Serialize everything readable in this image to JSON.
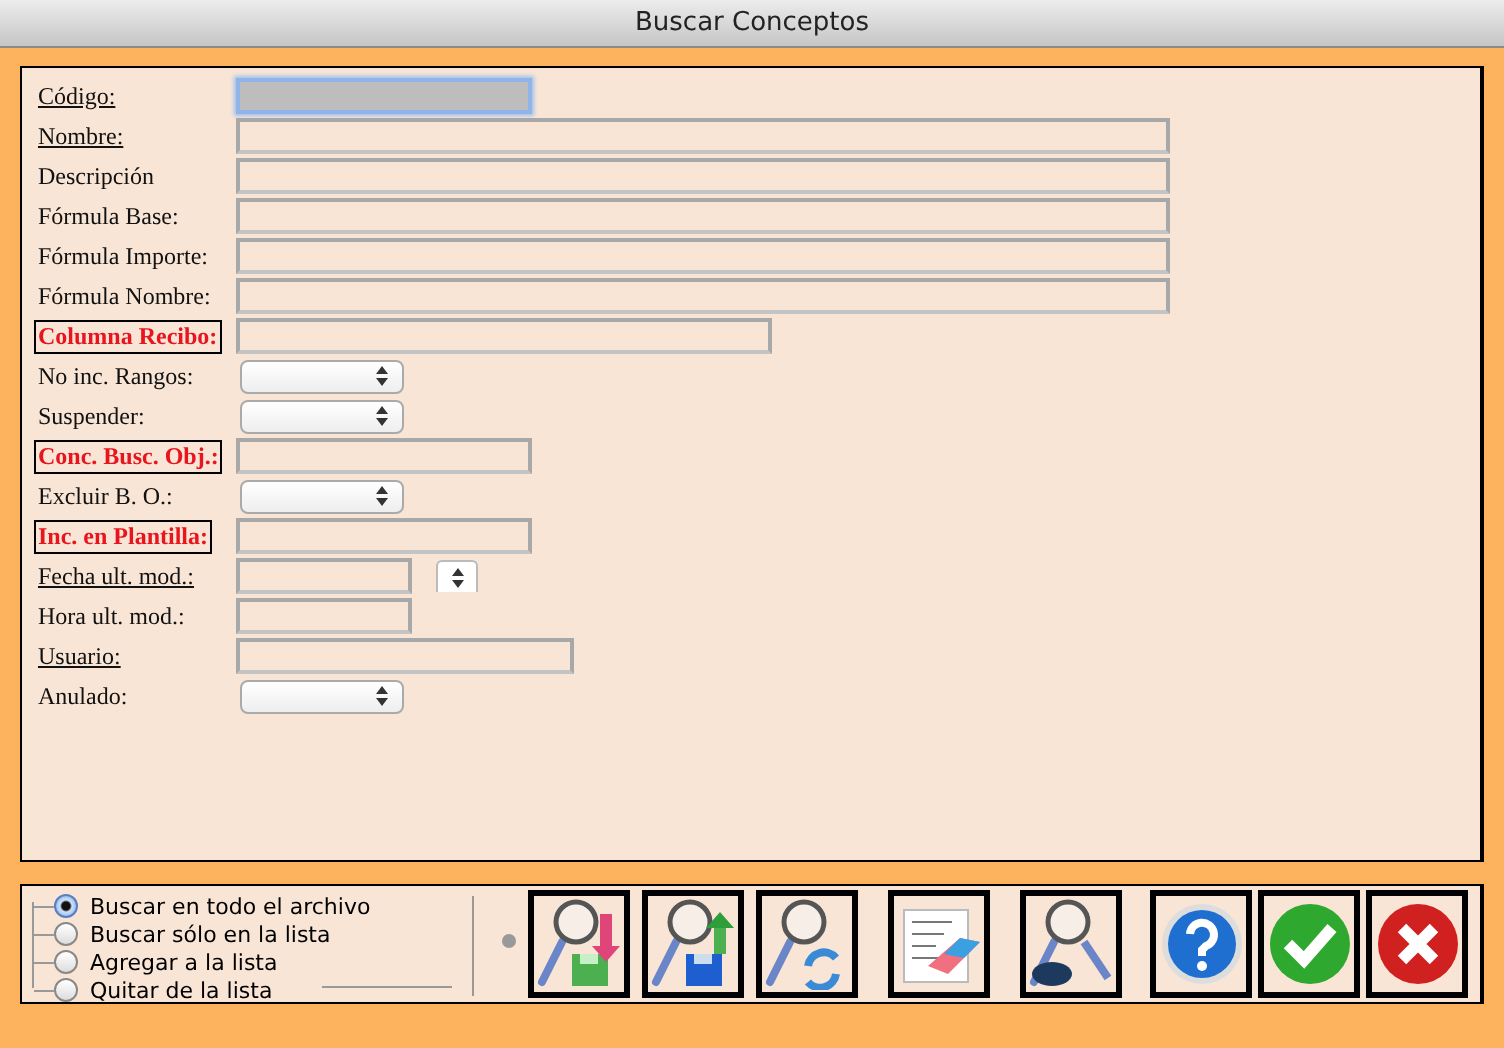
{
  "window": {
    "title": "Buscar Conceptos"
  },
  "fields": [
    {
      "label": "Código:",
      "required": true,
      "highlighted": false,
      "kind": "text-medium",
      "focused": true
    },
    {
      "label": "Nombre:",
      "required": true,
      "highlighted": false,
      "kind": "text-wide",
      "focused": false
    },
    {
      "label": "Descripción",
      "required": false,
      "highlighted": false,
      "kind": "text-wide",
      "focused": false
    },
    {
      "label": "Fórmula Base:",
      "required": false,
      "highlighted": false,
      "kind": "text-wide",
      "focused": false
    },
    {
      "label": "Fórmula Importe:",
      "required": false,
      "highlighted": false,
      "kind": "text-wide",
      "focused": false
    },
    {
      "label": "Fórmula Nombre:",
      "required": false,
      "highlighted": false,
      "kind": "text-wide",
      "focused": false
    },
    {
      "label": "Columna Recibo:",
      "required": false,
      "highlighted": true,
      "kind": "text-long",
      "focused": false
    },
    {
      "label": "No inc. Rangos:",
      "required": false,
      "highlighted": false,
      "kind": "popup",
      "focused": false
    },
    {
      "label": "Suspender:",
      "required": false,
      "highlighted": false,
      "kind": "popup",
      "focused": false
    },
    {
      "label": "Conc. Busc. Obj.:",
      "required": false,
      "highlighted": true,
      "kind": "text-medium",
      "focused": false
    },
    {
      "label": "Excluir B. O.:",
      "required": false,
      "highlighted": false,
      "kind": "popup",
      "focused": false
    },
    {
      "label": "Inc. en Plantilla:",
      "required": false,
      "highlighted": true,
      "kind": "text-medium",
      "focused": false
    },
    {
      "label": "Fecha ult. mod.:",
      "required": true,
      "highlighted": false,
      "kind": "date",
      "focused": false
    },
    {
      "label": "Hora ult. mod.:",
      "required": false,
      "highlighted": false,
      "kind": "text-short",
      "focused": false
    },
    {
      "label": "Usuario:",
      "required": true,
      "highlighted": false,
      "kind": "text-user",
      "focused": false
    },
    {
      "label": "Anulado:",
      "required": false,
      "highlighted": false,
      "kind": "popup",
      "focused": false
    }
  ],
  "search_mode": [
    {
      "label": "Buscar en todo el archivo",
      "selected": true
    },
    {
      "label": "Buscar sólo en la lista",
      "selected": false
    },
    {
      "label": "Agregar a la lista",
      "selected": false
    },
    {
      "label": "Quitar de la lista",
      "selected": false
    }
  ],
  "buttons": [
    {
      "kind": "find-load"
    },
    {
      "kind": "find-save"
    },
    {
      "kind": "find-refresh"
    },
    {
      "kind": "clear"
    },
    {
      "kind": "find-4d"
    },
    {
      "kind": "help"
    },
    {
      "kind": "accept"
    },
    {
      "kind": "cancel"
    }
  ]
}
